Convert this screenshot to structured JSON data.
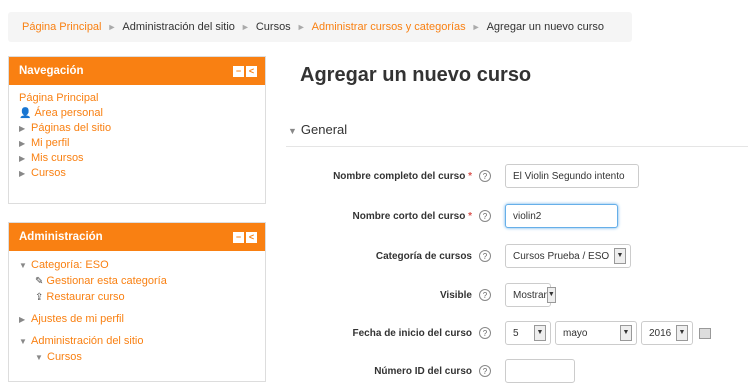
{
  "breadcrumb": {
    "items": [
      {
        "label": "Página Principal"
      },
      {
        "label": "Administración del sitio"
      },
      {
        "label": "Cursos"
      },
      {
        "label": "Administrar cursos y categorías"
      },
      {
        "label": "Agregar un nuevo curso"
      }
    ],
    "separator": "►"
  },
  "nav_block": {
    "title": "Navegación",
    "items": [
      {
        "label": "Página Principal"
      },
      {
        "label": "Área personal"
      },
      {
        "label": "Páginas del sitio"
      },
      {
        "label": "Mi perfil"
      },
      {
        "label": "Mis cursos"
      },
      {
        "label": "Cursos"
      }
    ]
  },
  "admin_block": {
    "title": "Administración",
    "items": [
      {
        "label": "Categoría: ESO"
      },
      {
        "label": "Gestionar esta categoría"
      },
      {
        "label": "Restaurar curso"
      },
      {
        "label": "Ajustes de mi perfil"
      },
      {
        "label": "Administración del sitio"
      },
      {
        "label": "Cursos"
      }
    ]
  },
  "page": {
    "title": "Agregar un nuevo curso",
    "section": "General"
  },
  "form": {
    "fullname": {
      "label": "Nombre completo del curso",
      "value": "El Violin Segundo intento"
    },
    "shortname": {
      "label": "Nombre corto del curso",
      "value": "violin2"
    },
    "category": {
      "label": "Categoría de cursos",
      "value": "Cursos Prueba / ESO"
    },
    "visible": {
      "label": "Visible",
      "value": "Mostrar"
    },
    "startdate": {
      "label": "Fecha de inicio del curso",
      "day": "5",
      "month": "mayo",
      "year": "2016"
    },
    "idnumber": {
      "label": "Número ID del curso",
      "value": ""
    }
  },
  "colors": {
    "accent": "#f98012",
    "focus": "#66afe9",
    "required": "#d9534f"
  },
  "icons": {
    "help": "help-icon",
    "person": "person-icon",
    "calendar": "calendar-icon"
  }
}
